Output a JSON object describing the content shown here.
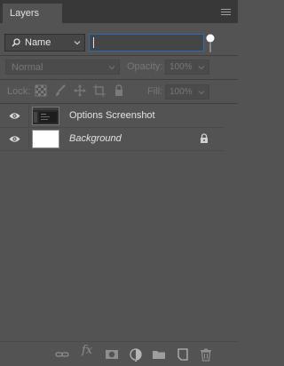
{
  "panel": {
    "title": "Layers"
  },
  "filter": {
    "kind_label": "Name",
    "value": ""
  },
  "blend": {
    "mode": "Normal",
    "opacity_label": "Opacity:",
    "opacity_value": "100%"
  },
  "lock": {
    "label": "Lock:",
    "fill_label": "Fill:",
    "fill_value": "100%"
  },
  "layers": [
    {
      "name": "Options Screenshot",
      "visible": true,
      "thumbnail": "dark-screenshot",
      "locked": false,
      "italic": false
    },
    {
      "name": "Background",
      "visible": true,
      "thumbnail": "white",
      "locked": true,
      "italic": true
    }
  ],
  "bottom_bar": {
    "icons": [
      "link-layers-icon",
      "fx-icon",
      "add-mask-icon",
      "adjustment-layer-icon",
      "new-group-icon",
      "new-layer-icon",
      "delete-layer-icon"
    ],
    "fx_label": "fx"
  },
  "colors": {
    "panel_bg": "#535353",
    "tab_bar_bg": "#383838",
    "input_focus_border": "#2d6ab7",
    "text": "#e4e4e4"
  }
}
